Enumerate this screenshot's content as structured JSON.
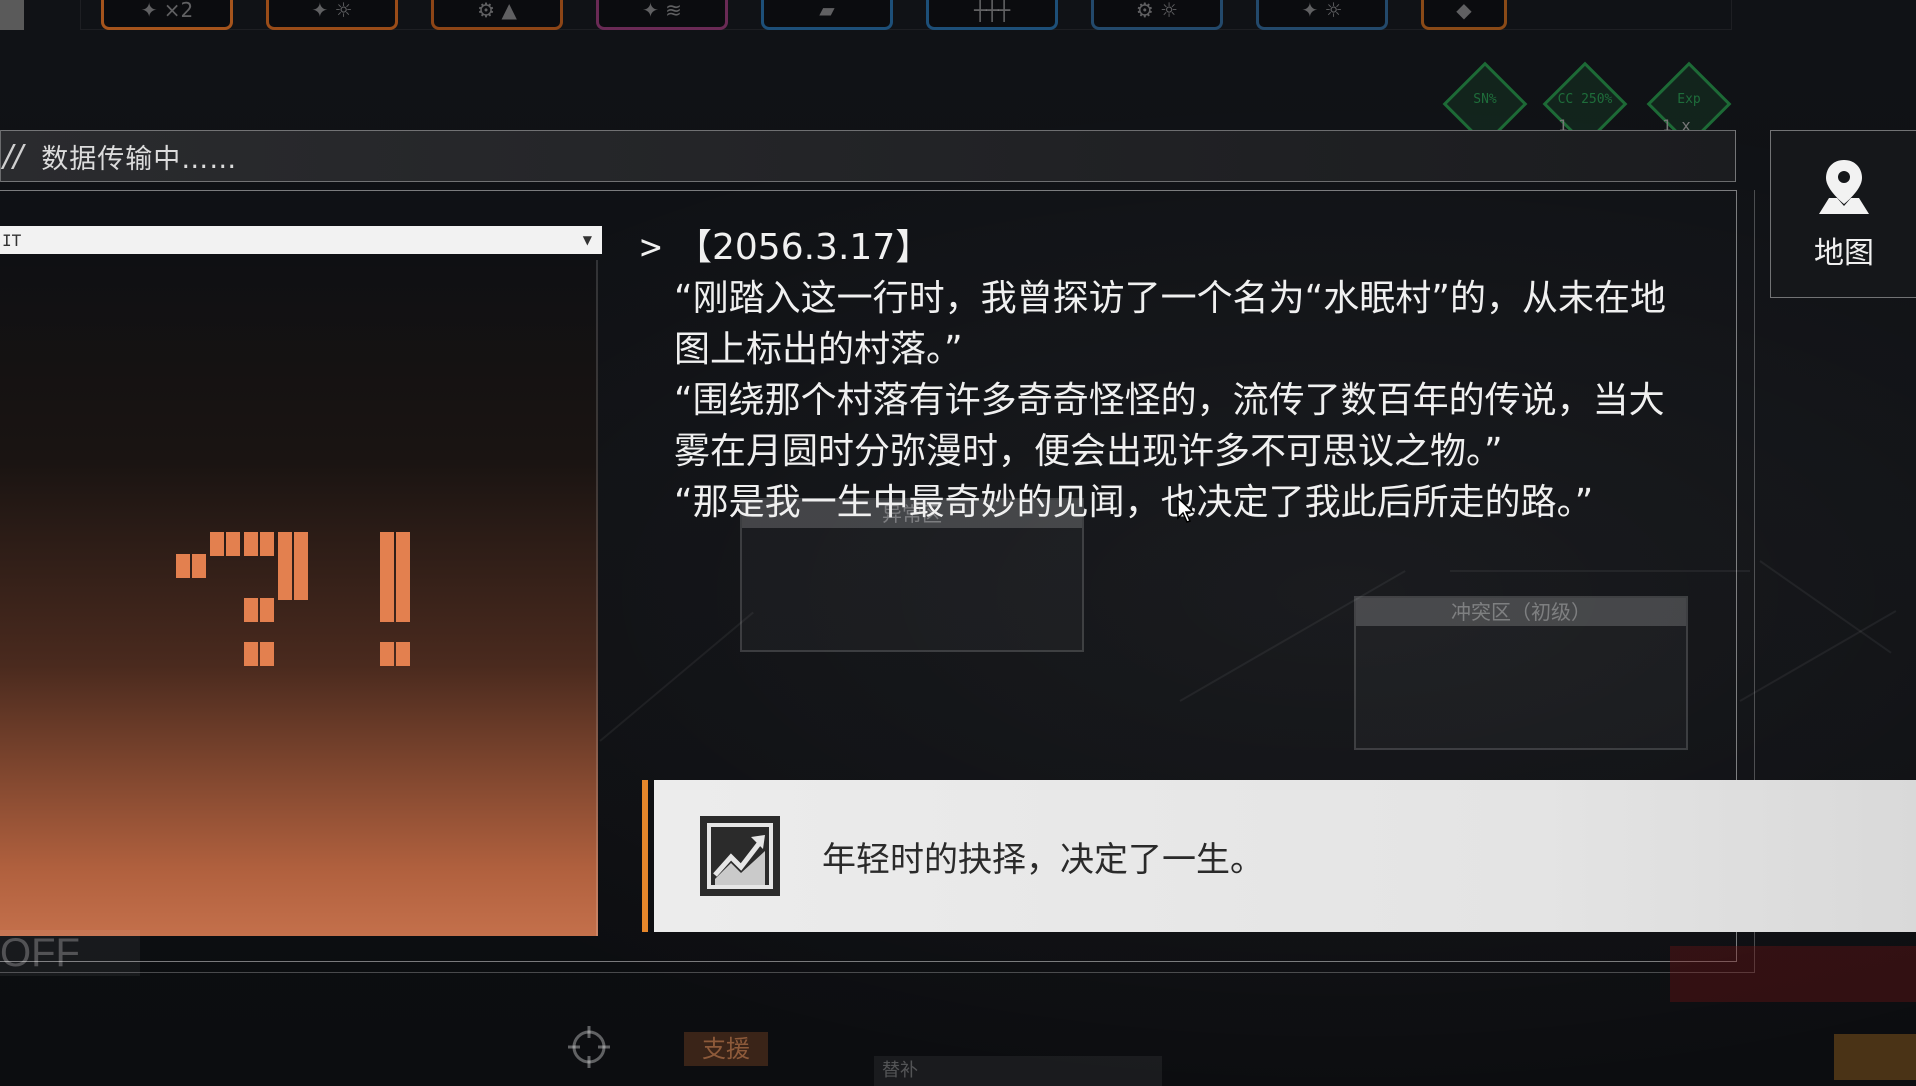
{
  "top_buttons": [
    {
      "glyph": "✦ ×2",
      "color": "#a5541c"
    },
    {
      "glyph": "✦ ☼",
      "color": "#9a4c18"
    },
    {
      "glyph": "⚙ ▲",
      "color": "#8d4516"
    },
    {
      "glyph": "✦ ≋",
      "color": "#6a2a55"
    },
    {
      "glyph": "▰",
      "color": "#1d4f78"
    },
    {
      "glyph": "┼┼┼",
      "color": "#1d4f78"
    },
    {
      "glyph": "⚙ ☼",
      "color": "#23496b"
    },
    {
      "glyph": "✦ ☼",
      "color": "#23496b"
    },
    {
      "glyph": "◆",
      "color": "#8a4a17"
    }
  ],
  "status_icons": [
    {
      "label": "SN%",
      "count": ""
    },
    {
      "label": "CC 250%",
      "count": "1"
    },
    {
      "label": "Exp",
      "count": "1 x"
    }
  ],
  "header": {
    "slashes": "//",
    "text": "数据传输中……"
  },
  "image_panel": {
    "dropdown_value": "IT",
    "glyph": "?!"
  },
  "dialog": {
    "prompt": ">",
    "date": "【2056.3.17】",
    "paragraphs": [
      "“刚踏入这一行时，我曾探访了一个名为“水眠村”的，从未在地图上标出的村落。”",
      "“围绕那个村落有许多奇奇怪怪的，流传了数百年的传说，当大雾在月圆时分弥漫时，便会出现许多不可思议之物。”",
      "“那是我一生中最奇妙的见闻，也决定了我此后所走的路。”"
    ]
  },
  "map_zones": {
    "abnormal": "异常区",
    "conflict": "冲突区（初级）"
  },
  "map_button": {
    "label": "地图",
    "icon": "map-pin-icon"
  },
  "banner": {
    "icon": "trend-up-chart-icon",
    "text": "年轻时的抉择，决定了一生。",
    "accent_color": "#e5862b"
  },
  "bottom": {
    "off_label": "OFF",
    "support_label": "支援",
    "replace_label": "替补"
  }
}
